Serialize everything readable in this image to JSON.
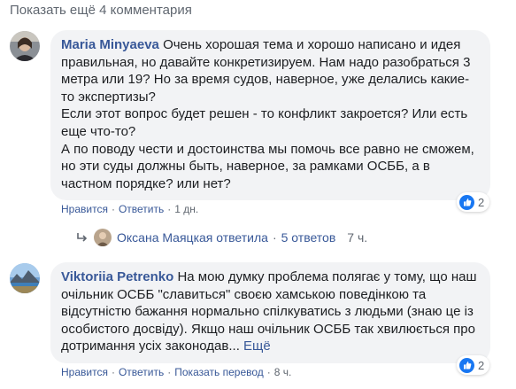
{
  "show_more": "Показать ещё 4 комментария",
  "comments": [
    {
      "author": "Maria Minyaeva",
      "text": [
        "Очень хорошая тема и хорошо написано и идея правильная, но давайте конкретизируем. Нам надо разобраться 3 метра или 19? Но за время судов, наверное, уже делались какие-то экспертизы?",
        "Если этот вопрос будет решен - то конфликт закроется? Или есть еще что-то?",
        "А по поводу чести и достоинства мы помочь все равно не сможем, но эти суды должны быть, наверное, за рамками ОСББ, а в частном порядке? или нет?"
      ],
      "reaction_count": "2",
      "actions": {
        "like": "Нравится",
        "reply": "Ответить",
        "time": "1 дн."
      }
    },
    {
      "author": "Viktoriia Petrenko",
      "text": "На мою думку проблема полягає у тому, що наш очільник ОСББ \"славиться\" своєю хамською поведінкою та відсутністю бажання нормально спілкуватись з людьми (знаю це із особистого досвіду). Якщо наш очільник ОСББ так хвилюється про дотримання усіх законодав...",
      "more": "Ещё",
      "reaction_count": "2",
      "actions": {
        "like": "Нравится",
        "reply": "Ответить",
        "translate": "Показать перевод",
        "time": "8 ч."
      }
    }
  ],
  "replies": {
    "author_text": "Оксана Маяцкая ответила",
    "count": "5 ответов",
    "time": "7 ч."
  },
  "colors": {
    "link": "#385898",
    "muted": "#606770",
    "bubble": "#f2f3f5",
    "like": "#1877f2"
  }
}
